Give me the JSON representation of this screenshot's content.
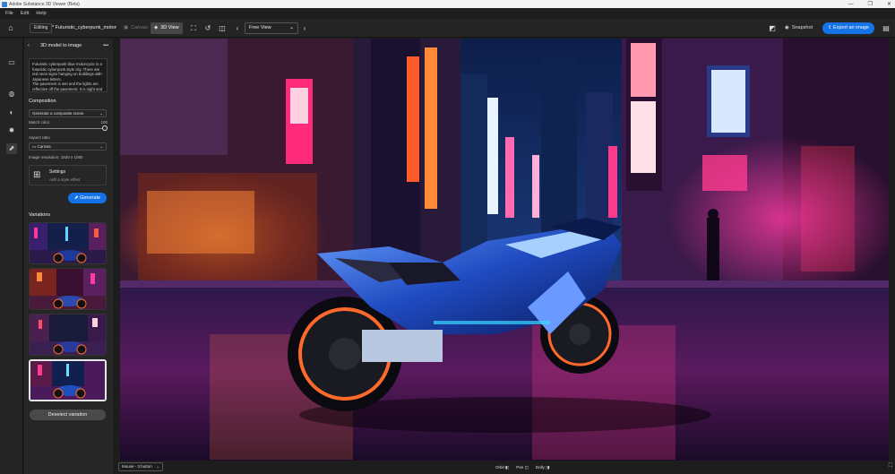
{
  "window": {
    "title": "Adobe Substance 3D Viewer (Beta)",
    "controls": [
      "—",
      "❐",
      "✕"
    ]
  },
  "menu": [
    "File",
    "Edit",
    "Help"
  ],
  "toolbar": {
    "editing_label": "Editing",
    "filename": "* Futuristic_cyberpunk_motorcycle",
    "canvas_label": "Canvas",
    "view3d_label": "3D View",
    "view_select": "Free View",
    "snapshot_label": "Snapshot",
    "export_label": "Export an image"
  },
  "panel": {
    "title": "3D model to image",
    "prompt": "Futuristic cyberpunk blue motorcycle in a futuristic cyberpunk style city. There are red neon signs hanging on buildings with Japanese letters.\nThe pavement is wet and the lights are reflective off the pavement. It is night and",
    "composition_label": "Composition",
    "composition_value": "Generate a composite scene",
    "match_color_label": "Match color",
    "match_color_value": "100",
    "match_color_level": 1.0,
    "aspect_ratio_label": "Aspect ratio",
    "aspect_ratio_value": "Canvas",
    "resolution_text": "Image resolution: 1920 x 1080",
    "settings_title": "Settings",
    "settings_sub": "Add a style effect",
    "generate_label": "Generate",
    "variations_label": "Variations",
    "deselect_label": "Deselect variation"
  },
  "statusbar": {
    "mouse_mode": "Mouse - 3 button",
    "orbit": "Orbit",
    "pan": "Pan",
    "dolly": "Dolly"
  },
  "colors": {
    "accent": "#1473e6",
    "neon_pink": "#ff2b8a",
    "neon_cyan": "#39d8ff",
    "neon_orange": "#ff7a1a"
  }
}
